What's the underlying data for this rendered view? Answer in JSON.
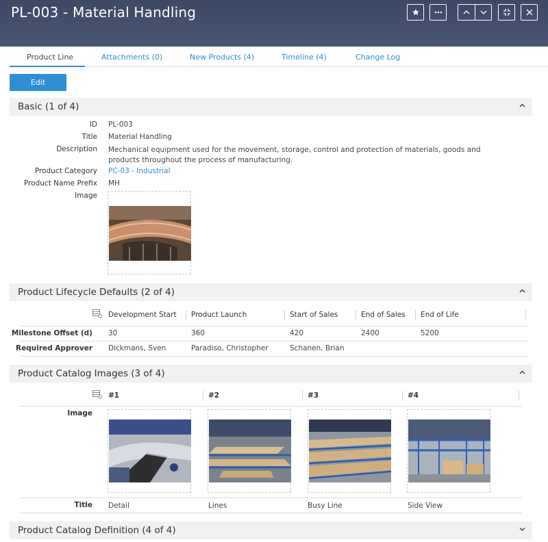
{
  "header": {
    "title": "PL-003 - Material Handling",
    "buttons": [
      "star-icon",
      "more-icon",
      "chevron-up-icon",
      "chevron-down-icon",
      "collapse-icon",
      "close-icon"
    ]
  },
  "tabs": [
    {
      "label": "Product Line",
      "active": true
    },
    {
      "label": "Attachments (0)"
    },
    {
      "label": "New Products (4)"
    },
    {
      "label": "Timeline (4)"
    },
    {
      "label": "Change Log"
    }
  ],
  "edit_label": "Edit",
  "basic": {
    "title": "Basic (1 of 4)",
    "fields": {
      "id": {
        "label": "ID",
        "value": "PL-003"
      },
      "title": {
        "label": "Title",
        "value": "Material Handling"
      },
      "description": {
        "label": "Description",
        "value": "Mechanical equipment used for the movement, storage, control and protection of materials, goods and products throughout the process of manufacturing."
      },
      "category": {
        "label": "Product Category",
        "value": "PC-03 - Industrial"
      },
      "prefix": {
        "label": "Product Name Prefix",
        "value": "MH"
      },
      "image": {
        "label": "Image"
      }
    }
  },
  "lifecycle": {
    "title": "Product Lifecycle Defaults (2 of 4)",
    "columns": [
      "Development Start",
      "Product Launch",
      "Start of Sales",
      "End of Sales",
      "End of Life"
    ],
    "rows": [
      {
        "label": "Milestone Offset (d)",
        "values": [
          "30",
          "360",
          "420",
          "2400",
          "5200"
        ]
      },
      {
        "label": "Required Approver",
        "values": [
          "Dickmans, Sven",
          "Paradiso, Christopher",
          "Schanen, Brian",
          "",
          ""
        ]
      }
    ]
  },
  "catalog_images": {
    "title": "Product Catalog Images (3 of 4)",
    "columns": [
      "#1",
      "#2",
      "#3",
      "#4"
    ],
    "image_label": "Image",
    "title_label": "Title",
    "titles": [
      "Detail",
      "Lines",
      "Busy Line",
      "Side View"
    ]
  },
  "catalog_definition": {
    "title": "Product Catalog Definition (4 of 4)"
  },
  "colors": {
    "header_bg": "#44506d",
    "accent": "#2f8bc9",
    "button": "#2e8ed6",
    "section_bg": "#f1f1f3"
  }
}
